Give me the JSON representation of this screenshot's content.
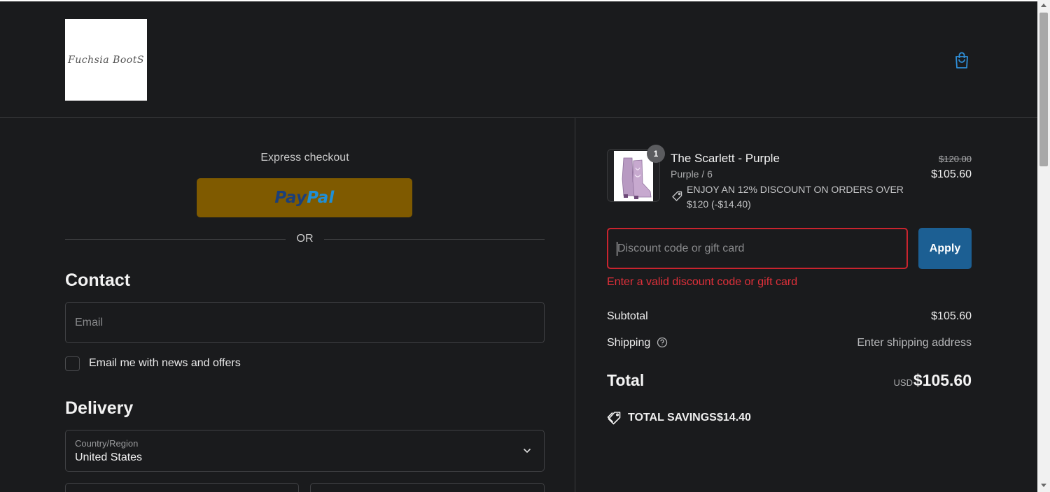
{
  "header": {
    "logo_text": "Fuchsia BootS",
    "cart_icon": "shopping-bag-icon"
  },
  "express": {
    "label": "Express checkout",
    "paypal_a": "Pay",
    "paypal_b": "Pal",
    "or": "OR"
  },
  "contact": {
    "heading": "Contact",
    "email_placeholder": "Email",
    "newsletter_label": "Email me with news and offers",
    "newsletter_checked": false
  },
  "delivery": {
    "heading": "Delivery",
    "country_label": "Country/Region",
    "country_value": "United States"
  },
  "summary": {
    "item": {
      "quantity": "1",
      "name": "The Scarlett - Purple",
      "variant": "Purple / 6",
      "discount_text": "ENJOY AN 12% DISCOUNT ON ORDERS OVER $120 (-$14.40)",
      "price_original": "$120.00",
      "price_current": "$105.60"
    },
    "discount_placeholder": "Discount code or gift card",
    "apply_label": "Apply",
    "error": "Enter a valid discount code or gift card",
    "subtotal_label": "Subtotal",
    "subtotal_value": "$105.60",
    "shipping_label": "Shipping",
    "shipping_value": "Enter shipping address",
    "total_label": "Total",
    "total_currency": "USD",
    "total_value": "$105.60",
    "savings_label": "TOTAL SAVINGS",
    "savings_value": "$14.40"
  },
  "colors": {
    "background": "#1a1b1d",
    "paypal_button": "#7f5a00",
    "apply_button": "#1c5f93",
    "error": "#e0303a",
    "cart_icon": "#2f8fd8"
  }
}
